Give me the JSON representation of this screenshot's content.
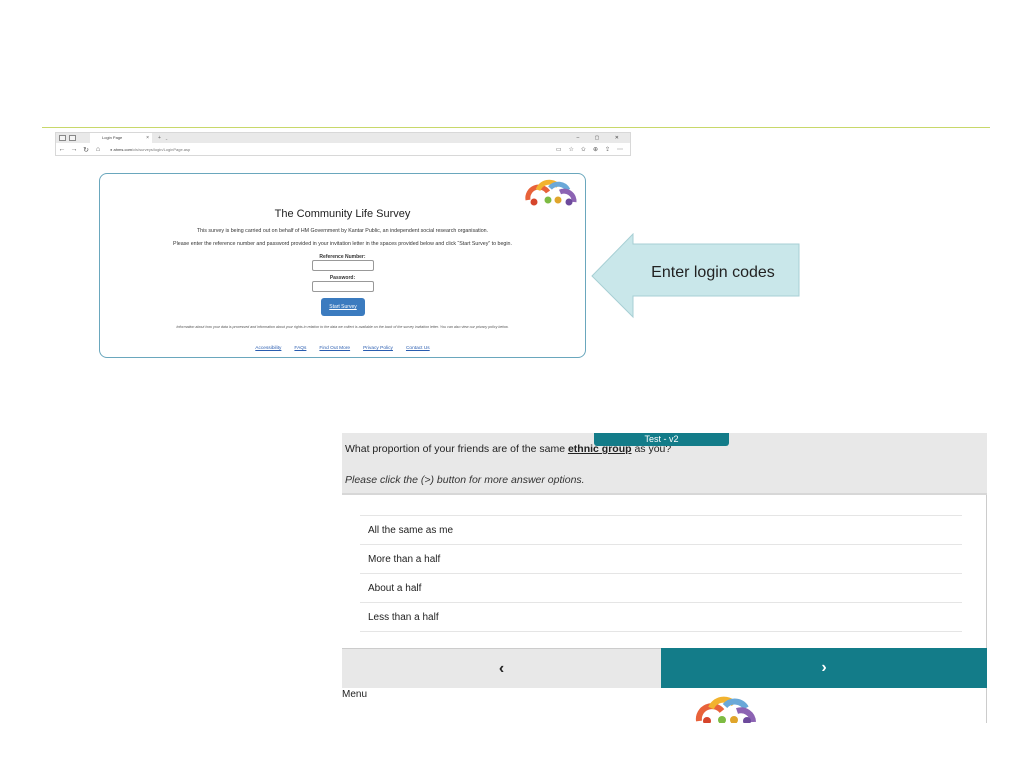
{
  "browser": {
    "tab_title": "Login Page",
    "tab_close": "×",
    "new_tab": "+",
    "tab_dropdown": "⌄",
    "window_controls": "–  ▢  ✕",
    "nav_icons": {
      "back": "←",
      "forward": "→",
      "refresh": "↻",
      "home": "⌂"
    },
    "lock_icon": "🔒",
    "url_host": "ahms.com",
    "url_path": "/cls/surveys/login/LoginPage.asp",
    "toolbar_icons": [
      "▭",
      "☆",
      "✩",
      "⊕",
      "⇪",
      "⋯"
    ]
  },
  "login": {
    "title": "The Community Life Survey",
    "description": "This survey is being carried out on behalf of HM Government by Kantar Public, an independent social research organisation.",
    "instruction": "Please enter the reference number and password provided in your invitation letter in the spaces provided below and click “Start Survey” to begin.",
    "reference_label": "Reference Number:",
    "password_label": "Password:",
    "reference_value": "",
    "password_value": "",
    "start_button": "Start Survey",
    "info_text": "Information about how your data is processed and information about your rights in relation to the data we collect is available on the back of the survey invitation letter. You can also view our privacy policy below.",
    "footer_links": [
      "Accessibility",
      "FAQs",
      "Find Out More",
      "Privacy Policy",
      "Contact Us"
    ]
  },
  "callout": {
    "text": "Enter login codes"
  },
  "survey": {
    "badge": "Test - v2",
    "question_prefix": "What proportion of your friends are of the same ",
    "question_term": "ethnic group",
    "question_suffix": " as you?",
    "hint": "Please click the (>) button for more answer options.",
    "options": [
      "All the same as me",
      "More than a half",
      "About a half",
      "Less than a half"
    ],
    "prev_icon": "‹",
    "next_icon": "›",
    "menu_label": "Menu"
  },
  "colors": {
    "accent_teal": "#137c89",
    "rule_green": "#c8d86a",
    "callout_fill": "#c9e7ea",
    "button_blue": "#3b7bbf"
  }
}
